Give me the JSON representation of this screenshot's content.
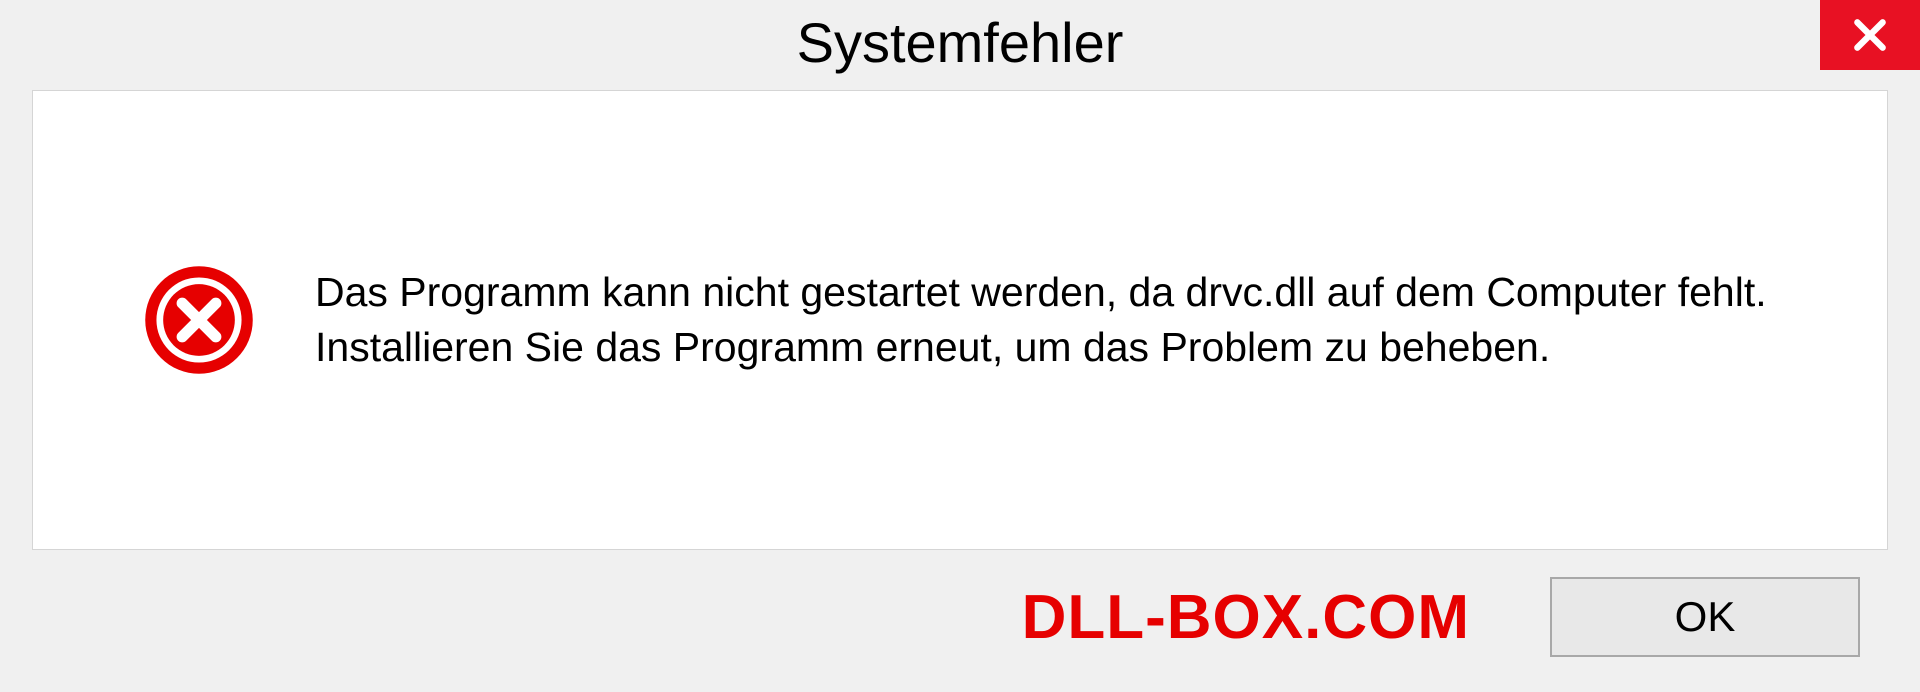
{
  "dialog": {
    "title": "Systemfehler",
    "message": "Das Programm kann nicht gestartet werden, da drvc.dll auf dem Computer fehlt. Installieren Sie das Programm erneut, um das Problem zu beheben.",
    "ok_label": "OK"
  },
  "watermark": "DLL-BOX.COM"
}
